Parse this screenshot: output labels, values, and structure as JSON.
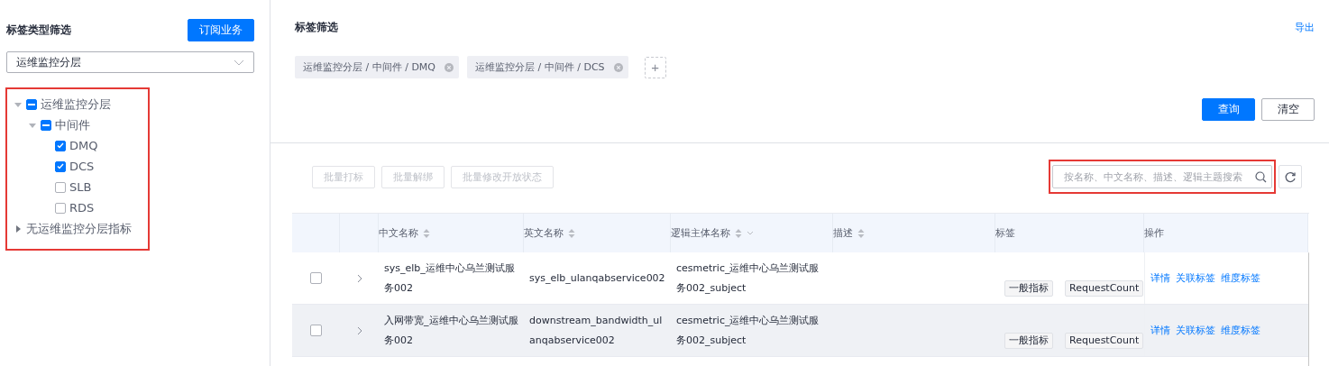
{
  "sidebar": {
    "title": "标签类型筛选",
    "subscribe_button": "订阅业务",
    "type_select": {
      "value": "运维监控分层"
    },
    "tree": [
      {
        "label": "运维监控分层",
        "indeterminate": true,
        "expanded": true,
        "children": [
          {
            "label": "中间件",
            "indeterminate": true,
            "expanded": true,
            "children": [
              {
                "label": "DMQ",
                "checked": true
              },
              {
                "label": "DCS",
                "checked": true
              },
              {
                "label": "SLB",
                "checked": false
              },
              {
                "label": "RDS",
                "checked": false
              }
            ]
          }
        ]
      },
      {
        "label": "无运维监控分层指标",
        "expanded": false
      }
    ],
    "tree_highlighted": true
  },
  "filter": {
    "title": "标签筛选",
    "export_link": "导出",
    "tags": [
      {
        "label": "运维监控分层 / 中间件 / DMQ"
      },
      {
        "label": "运维监控分层 / 中间件 / DCS"
      }
    ],
    "add_button": "+",
    "query_button": "查询",
    "clear_button": "清空"
  },
  "toolbar": {
    "batch_buttons": [
      {
        "label": "批量打标",
        "disabled": true
      },
      {
        "label": "批量解绑",
        "disabled": true
      },
      {
        "label": "批量修改开放状态",
        "disabled": true
      }
    ],
    "search": {
      "placeholder": "按名称、中文名称、描述、逻辑主题搜索",
      "highlighted": true
    }
  },
  "table": {
    "columns": [
      {
        "label": "中文名称",
        "sortable": true,
        "filterable": false
      },
      {
        "label": "英文名称",
        "sortable": true,
        "filterable": false
      },
      {
        "label": "逻辑主体名称",
        "sortable": true,
        "filterable": true
      },
      {
        "label": "描述",
        "sortable": true,
        "filterable": false
      },
      {
        "label": "标签",
        "sortable": false,
        "filterable": false
      },
      {
        "label": "操作",
        "sortable": false,
        "filterable": false
      }
    ],
    "rows": [
      {
        "checked": false,
        "hovered": false,
        "cn_name": "sys_elb_运维中心乌兰测试服务002",
        "en_name": "sys_elb_ulanqabservice002",
        "subject": "cesmetric_运维中心乌兰测试服务002_subject",
        "tags": [
          "一般指标",
          "RequestCount"
        ],
        "actions": [
          "详情",
          "关联标签",
          "维度标签"
        ]
      },
      {
        "checked": false,
        "hovered": true,
        "cn_name": "入网带宽_运维中心乌兰测试服务002",
        "en_name": "downstream_bandwidth_ulanqabservice002",
        "subject": "cesmetric_运维中心乌兰测试服务002_subject",
        "tags": [
          "一般指标",
          "RequestCount"
        ],
        "actions": [
          "详情",
          "关联标签",
          "维度标签"
        ]
      }
    ]
  }
}
